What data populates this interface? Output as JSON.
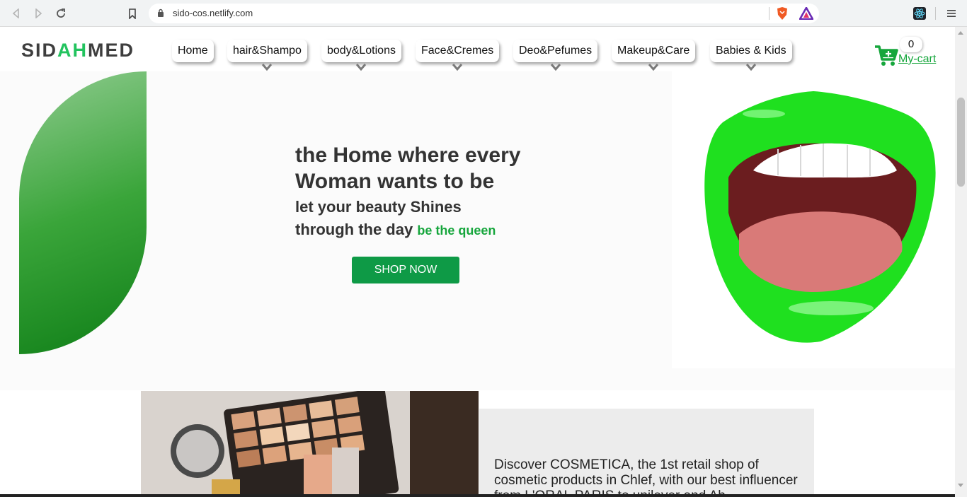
{
  "browser": {
    "url": "sido-cos.netlify.com"
  },
  "logo": {
    "part1": "SID",
    "part2": "AH",
    "part3": "MED"
  },
  "nav": {
    "items": [
      {
        "label": "Home"
      },
      {
        "label": "hair&Shampo"
      },
      {
        "label": "body&Lotions"
      },
      {
        "label": "Face&Cremes"
      },
      {
        "label": "Deo&Pefumes"
      },
      {
        "label": "Makeup&Care"
      },
      {
        "label": "Babies & Kids"
      }
    ]
  },
  "cart": {
    "count": "0",
    "label": "My-cart"
  },
  "hero": {
    "title_line1": "the Home where every",
    "title_line2": "Woman wants to be",
    "sub_line1": "let your beauty Shines",
    "sub_line2": "through the day",
    "accent": "be the queen",
    "button": "SHOP NOW"
  },
  "about": {
    "text": "Discover COSMETICA, the 1st retail shop of cosmetic products in Chlef, with our best influencer from L'ORAL PARIS to unilever and Ah"
  },
  "colors": {
    "brand_green": "#22c35e",
    "button_green": "#0e9a46",
    "lips_green": "#1fe01f"
  }
}
